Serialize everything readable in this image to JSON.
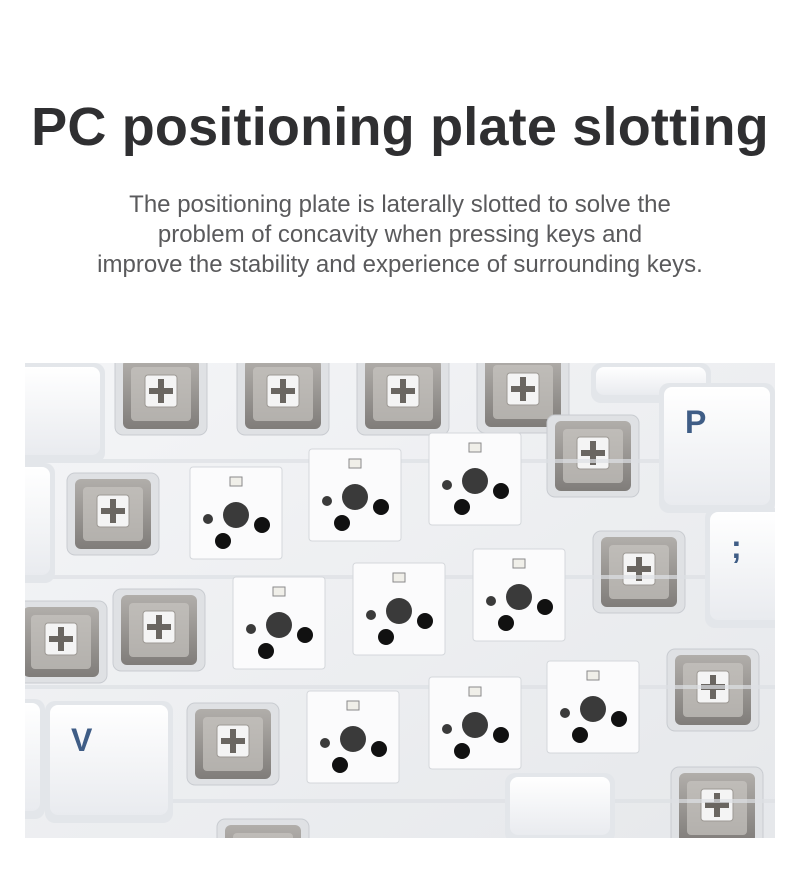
{
  "headline": "PC positioning plate slotting",
  "description": {
    "lines": [
      "The positioning plate is laterally slotted to solve the",
      "problem of concavity when pressing keys and",
      "improve the stability and experience of surrounding keys."
    ]
  },
  "photo": {
    "keycap_letters": [
      "P",
      "V",
      ";"
    ],
    "colors": {
      "background": "#ffffff",
      "plate": "#eef0f2",
      "keycap": "#f7f8fa",
      "keycap_legend": "#3f5d86",
      "switch_housing": "#8a8783",
      "pcb_socket_hole": "#111111"
    }
  }
}
